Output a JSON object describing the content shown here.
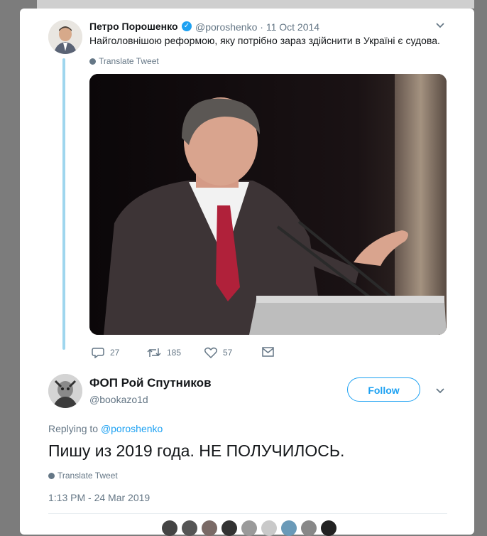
{
  "original_tweet": {
    "author_name": "Петро Порошенко",
    "handle": "@poroshenko",
    "date": "· 11 Oct 2014",
    "text": "Найголовнішою реформою, яку потрібно зараз здійснити в Україні є судова.",
    "translate_label": "Translate Tweet",
    "stats": {
      "replies": "27",
      "retweets": "185",
      "likes": "57"
    }
  },
  "reply_tweet": {
    "author_name": "ФОП Рой Спутников",
    "handle": "@bookazo1d",
    "follow_label": "Follow",
    "replying_prefix": "Replying to",
    "replying_to": "@poroshenko",
    "text": "Пишу из 2019 года. НЕ ПОЛУЧИЛОСЬ.",
    "translate_label": "Translate Tweet",
    "timestamp": "1:13 PM - 24 Mar 2019"
  },
  "colors": {
    "accent": "#1da1f2",
    "muted": "#657786",
    "thread_line": "#9fd6ee"
  }
}
